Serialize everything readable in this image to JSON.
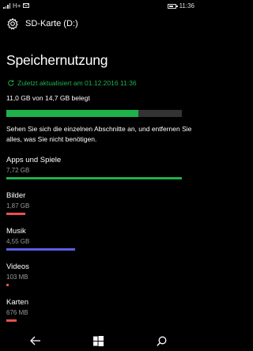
{
  "status": {
    "carrier_label": "H+",
    "time": "11:36"
  },
  "header": {
    "icon": "gear-icon",
    "title": "SD-Karte (D:)"
  },
  "page_title": "Speichernutzung",
  "refresh": {
    "icon": "refresh-icon",
    "text": "Zuletzt aktualisiert am 01.12.2016 11:36"
  },
  "usage": {
    "text": "11,0 GB von 14,7 GB belegt",
    "used_fraction": 0.75,
    "color": "#1fb14a"
  },
  "description": "Sehen Sie sich die einzelnen Abschnitte an, und entfernen Sie alles, was Sie nicht benötigen.",
  "categories": [
    {
      "name": "Apps und Spiele",
      "size": "7,72 GB",
      "fraction": 1.0,
      "color": "#1fb14a"
    },
    {
      "name": "Bilder",
      "size": "1,87 GB",
      "fraction": 0.11,
      "color": "#e8504a"
    },
    {
      "name": "Musik",
      "size": "4,55 GB",
      "fraction": 0.39,
      "color": "#5a5ee6"
    },
    {
      "name": "Videos",
      "size": "103 MB",
      "fraction": 0.012,
      "color": "#e8504a"
    },
    {
      "name": "Karten",
      "size": "676 MB",
      "fraction": 0.06,
      "color": "#e8504a"
    }
  ],
  "navbar": {
    "back_icon": "back-arrow-icon",
    "start_icon": "windows-icon",
    "search_icon": "search-icon"
  }
}
